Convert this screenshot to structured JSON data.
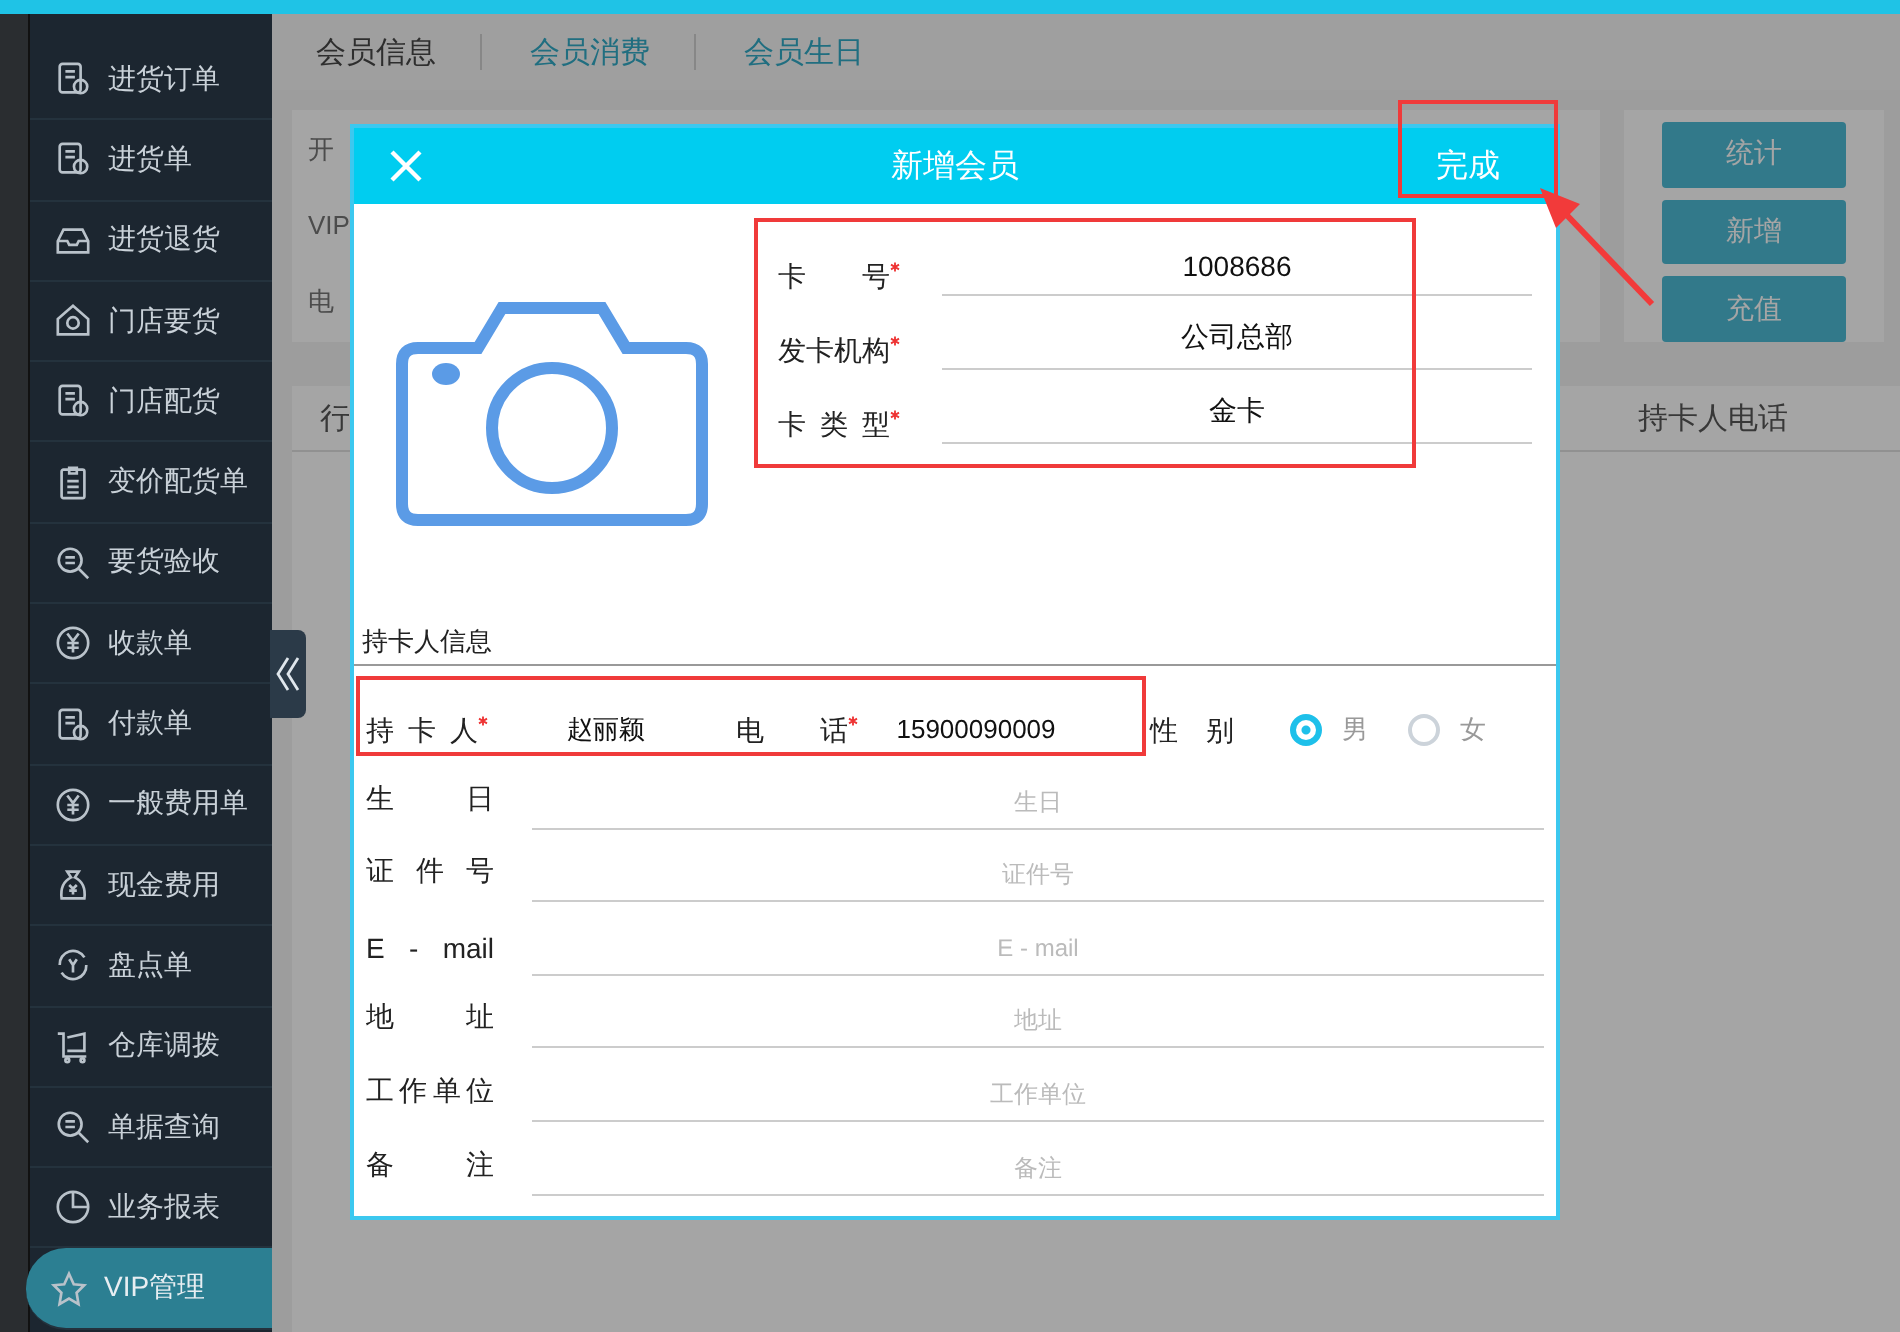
{
  "sidebar": {
    "items": [
      {
        "label": "进货订单",
        "selected": false
      },
      {
        "label": "进货单",
        "selected": false
      },
      {
        "label": "进货退货",
        "selected": false
      },
      {
        "label": "门店要货",
        "selected": false
      },
      {
        "label": "门店配货",
        "selected": false
      },
      {
        "label": "变价配货单",
        "selected": false
      },
      {
        "label": "要货验收",
        "selected": false
      },
      {
        "label": "收款单",
        "selected": false
      },
      {
        "label": "付款单",
        "selected": false
      },
      {
        "label": "一般费用单",
        "selected": false
      },
      {
        "label": "现金费用",
        "selected": false
      },
      {
        "label": "盘点单",
        "selected": false
      },
      {
        "label": "仓库调拨",
        "selected": false
      },
      {
        "label": "单据查询",
        "selected": false
      },
      {
        "label": "业务报表",
        "selected": false
      },
      {
        "label": "VIP管理",
        "selected": true
      }
    ]
  },
  "tabs": [
    {
      "label": "会员信息",
      "selected": true
    },
    {
      "label": "会员消费",
      "selected": false
    },
    {
      "label": "会员生日",
      "selected": false
    }
  ],
  "filter": {
    "labels": [
      "开",
      "VIP",
      "电"
    ]
  },
  "actions": [
    "统计",
    "新增",
    "充值"
  ],
  "table": {
    "columns": [
      "行",
      "持卡人电话"
    ]
  },
  "modal": {
    "title": "新增会员",
    "done": "完成",
    "card_fields": [
      {
        "label": "卡号",
        "value": "1008686",
        "required": true
      },
      {
        "label": "发卡机构",
        "value": "公司总部",
        "required": true
      },
      {
        "label": "卡类型",
        "value": "金卡",
        "required": true
      }
    ],
    "section_title": "持卡人信息",
    "holder": {
      "label": "持卡人",
      "value": "赵丽颖",
      "required": true
    },
    "phone": {
      "label": "电话",
      "value": "15900090009",
      "required": true
    },
    "gender": {
      "label": "性别",
      "options": [
        {
          "label": "男",
          "selected": true
        },
        {
          "label": "女",
          "selected": false
        }
      ]
    },
    "detail_fields": [
      {
        "label": "生日",
        "placeholder": "生日"
      },
      {
        "label": "证件号",
        "placeholder": "证件号"
      },
      {
        "label": "E - mail",
        "placeholder": "E - mail"
      },
      {
        "label": "地址",
        "placeholder": "地址"
      },
      {
        "label": "工作单位",
        "placeholder": "工作单位"
      },
      {
        "label": "备注",
        "placeholder": "备注"
      }
    ]
  }
}
